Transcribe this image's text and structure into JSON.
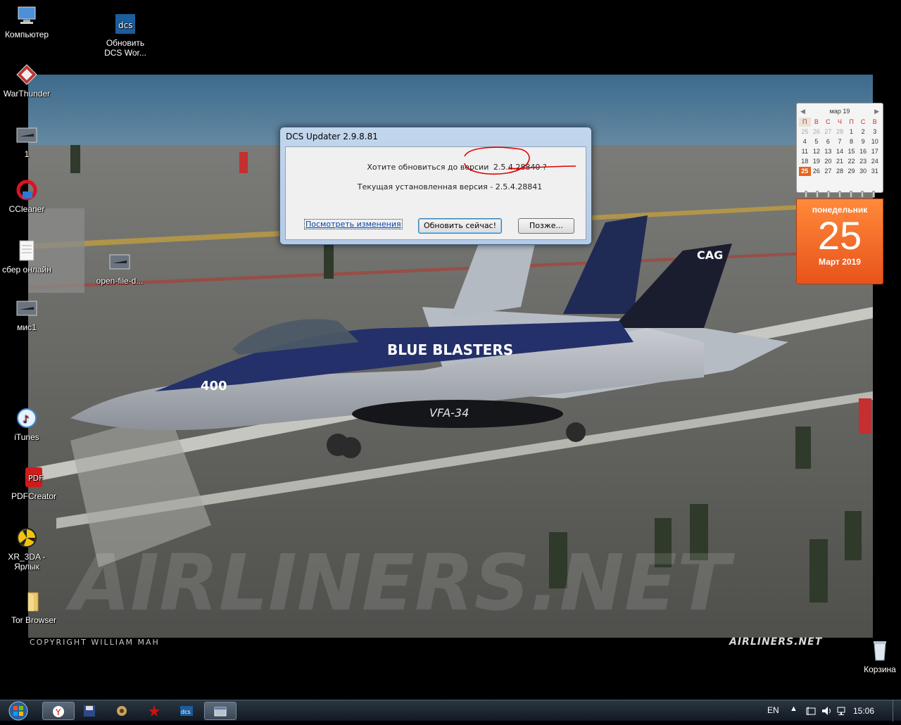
{
  "desktop_icons": [
    {
      "label": "Компьютер",
      "icon": "computer-icon"
    },
    {
      "label": "Обновить DCS Wor...",
      "icon": "dcs-icon"
    },
    {
      "label": "WarThunder",
      "icon": "warthunder-icon"
    },
    {
      "label": "1",
      "icon": "jet-thumbnail-icon"
    },
    {
      "label": "CCleaner",
      "icon": "ccleaner-icon"
    },
    {
      "label": "сбер онлайн",
      "icon": "document-icon"
    },
    {
      "label": "open-file-d...",
      "icon": "jet-thumbnail-icon"
    },
    {
      "label": "мис1",
      "icon": "jet-thumbnail-icon"
    },
    {
      "label": "iTunes",
      "icon": "itunes-icon"
    },
    {
      "label": "PDFCreator",
      "icon": "pdfcreator-icon"
    },
    {
      "label": "XR_3DA - Ярлык",
      "icon": "xray-icon"
    },
    {
      "label": "Tor Browser",
      "icon": "folder-icon"
    },
    {
      "label": "Корзина",
      "icon": "recycle-bin-icon"
    }
  ],
  "wallpaper": {
    "copyright": "COPYRIGHT WILLIAM MAH",
    "watermark": "AIRLINERS.NET",
    "jet_text": "BLUE BLASTERS",
    "jet_number": "400",
    "jet_squadron": "VFA-34",
    "tail_code": "CAG"
  },
  "dialog": {
    "title": "DCS Updater 2.9.8.81",
    "question": "Хотите обновиться до версии",
    "new_version": "2.5.4.28840 ?",
    "current_version": "Текущая установленная версия - 2.5.4.28841",
    "link_label": "Посмотреть изменения",
    "update_button": "Обновить сейчас!",
    "later_button": "Позже...",
    "annotation_color": "#e00000"
  },
  "calendar": {
    "month_year": "мар 19",
    "weekdays": [
      "П",
      "В",
      "С",
      "Ч",
      "П",
      "С",
      "В"
    ],
    "weeks": [
      [
        "25",
        "26",
        "27",
        "28",
        "1",
        "2",
        "3"
      ],
      [
        "4",
        "5",
        "6",
        "7",
        "8",
        "9",
        "10"
      ],
      [
        "11",
        "12",
        "13",
        "14",
        "15",
        "16",
        "17"
      ],
      [
        "18",
        "19",
        "20",
        "21",
        "22",
        "23",
        "24"
      ],
      [
        "25",
        "26",
        "27",
        "28",
        "29",
        "30",
        "31"
      ]
    ],
    "today": "25",
    "weekday_name": "понедельник",
    "day": "25",
    "month_year_full": "Март 2019",
    "accent": "#e8621b"
  },
  "taskbar": {
    "start_icon": "windows-start-icon",
    "buttons": [
      {
        "icon": "yandex-browser-icon",
        "active": true
      },
      {
        "icon": "save-disk-icon",
        "active": false
      },
      {
        "icon": "game-launcher-icon",
        "active": false
      },
      {
        "icon": "red-star-icon",
        "active": false
      },
      {
        "icon": "dcs-icon",
        "active": false
      },
      {
        "icon": "dcs-updater-window-icon",
        "active": true
      }
    ],
    "language": "EN",
    "clock": "15:06"
  }
}
